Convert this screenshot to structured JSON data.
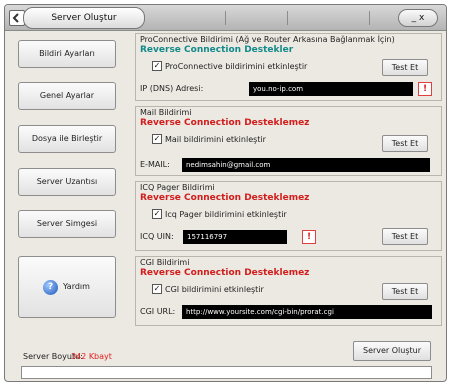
{
  "window": {
    "title": "Server Oluştur",
    "close_label": "_ x"
  },
  "sidebar": {
    "items": [
      {
        "label": "Bildiri Ayarları"
      },
      {
        "label": "Genel Ayarlar"
      },
      {
        "label": "Dosya ile Birleştir"
      },
      {
        "label": "Server Uzantısı"
      },
      {
        "label": "Server Simgesi"
      }
    ],
    "help_label": "Yardım"
  },
  "sections": {
    "proconnective": {
      "title": "ProConnective Bildirimi (Ağ ve Router Arkasına Bağlanmak İçin)",
      "status": "Reverse Connection Destekler",
      "checkbox_label": "ProConnective bildirimini etkinleştir",
      "field_label": "IP (DNS) Adresi:",
      "field_value": "you.no-ip.com",
      "test_label": "Test Et"
    },
    "mail": {
      "title": "Mail Bildirimi",
      "status": "Reverse Connection Desteklemez",
      "checkbox_label": "Mail bildirimini etkinleştir",
      "field_label": "E-MAIL:",
      "field_value": "nedimsahin@gmail.com",
      "test_label": "Test Et"
    },
    "icq": {
      "title": "ICQ Pager Bildirimi",
      "status": "Reverse Connection Desteklemez",
      "checkbox_label": "Icq Pager bildirimini etkinleştir",
      "field_label": "ICQ UIN:",
      "field_value": "157116797",
      "test_label": "Test Et"
    },
    "cgi": {
      "title": "CGI Bildirimi",
      "status": "Reverse Connection Desteklemez",
      "checkbox_label": "CGI bildirimini etkinleştir",
      "field_label": "CGI URL:",
      "field_value": "http://www.yoursite.com/cgi-bin/prorat.cgi",
      "test_label": "Test Et"
    }
  },
  "footer": {
    "size_label": "Server Boyutu:",
    "size_value": "342 Kbayt",
    "create_label": "Server Oluştur"
  },
  "icons": {
    "app": "app-icon",
    "checked": "checkbox-checked-icon",
    "warning": "warning-icon",
    "help": "help-icon"
  },
  "colors": {
    "status_ok": "#138a8a",
    "status_bad": "#d21d1d",
    "size_value": "#e02020"
  }
}
